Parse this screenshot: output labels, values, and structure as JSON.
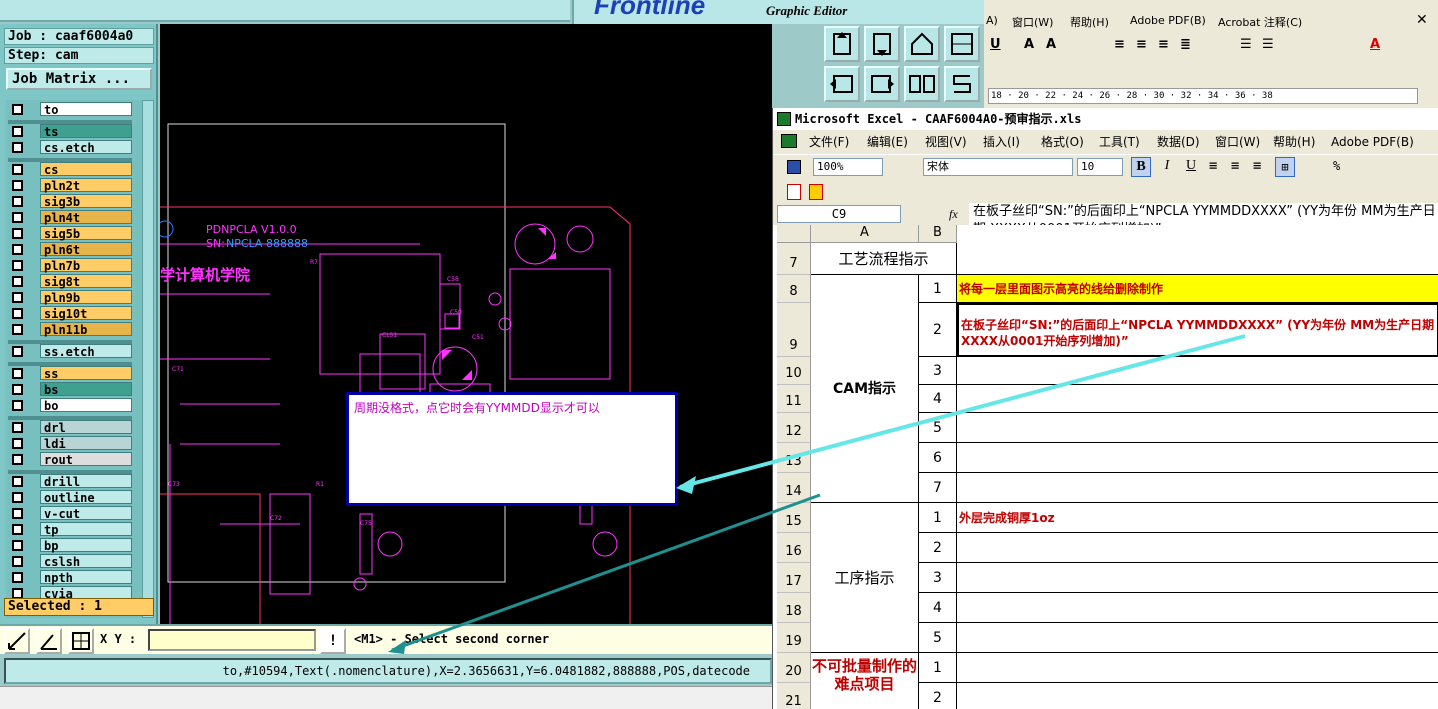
{
  "genesis": {
    "brand": "Frontline",
    "brand_sub": "Graphic Editor",
    "job": "Job : caaf6004a0",
    "step": "Step: cam",
    "job_matrix": "Job Matrix ...",
    "selected": "Selected : 1",
    "xy_label": "X Y :",
    "xy_value": "",
    "prompt": "<M1> - Select second corner",
    "status": "to,#10594,Text(.nomenclature),X=2.3656631,Y=6.0481882,888888,POS,datecode",
    "layers": [
      {
        "name": "to",
        "color": "#ffffff"
      },
      {
        "name": "ts",
        "color": "#3fa08f"
      },
      {
        "name": "cs.etch",
        "color": "#bfeaea"
      },
      {
        "name": "cs",
        "color": "#ffcc66"
      },
      {
        "name": "pln2t",
        "color": "#ffcc66"
      },
      {
        "name": "sig3b",
        "color": "#ffcc66"
      },
      {
        "name": "pln4t",
        "color": "#e8b44a"
      },
      {
        "name": "sig5b",
        "color": "#ffcc66"
      },
      {
        "name": "pln6t",
        "color": "#e8b44a"
      },
      {
        "name": "pln7b",
        "color": "#ffcc66"
      },
      {
        "name": "sig8t",
        "color": "#ffcc66"
      },
      {
        "name": "pln9b",
        "color": "#ffcc66"
      },
      {
        "name": "sig10t",
        "color": "#ffcc66"
      },
      {
        "name": "pln11b",
        "color": "#e8b44a"
      },
      {
        "name": "ss.etch",
        "color": "#bfeaea"
      },
      {
        "name": "ss",
        "color": "#ffcc66"
      },
      {
        "name": "bs",
        "color": "#3fa08f"
      },
      {
        "name": "bo",
        "color": "#ffffff"
      },
      {
        "name": "drl",
        "color": "#b9d4d4"
      },
      {
        "name": "ldi",
        "color": "#b9d4d4"
      },
      {
        "name": "rout",
        "color": "#dddddd"
      },
      {
        "name": "drill",
        "color": "#bfeaea"
      },
      {
        "name": "outline",
        "color": "#bfeaea"
      },
      {
        "name": "v-cut",
        "color": "#bfeaea"
      },
      {
        "name": "tp",
        "color": "#bfeaea"
      },
      {
        "name": "bp",
        "color": "#bfeaea"
      },
      {
        "name": "cslsh",
        "color": "#bfeaea"
      },
      {
        "name": "npth",
        "color": "#bfeaea"
      },
      {
        "name": "cvia",
        "color": "#bfeaea"
      }
    ],
    "board_text": {
      "title": "PDNPCLA V1.0.0",
      "sn_prefix": "SN:",
      "sn_value": "NPCLA 888888",
      "school": "学计算机学院",
      "c58": "C58",
      "c50": "C50",
      "c51": "C51",
      "cl51": "CL51",
      "r7": "R7",
      "c71": "C71",
      "c73": "C73",
      "c72": "C72",
      "c75": "C75",
      "r1": "R1"
    }
  },
  "note_text": "周期没格式，点它时会有YYMMDD显示才可以",
  "word": {
    "menu": [
      "A)",
      "窗口(W)",
      "帮助(H)",
      "Adobe PDF(B)",
      "Acrobat 注释(C)"
    ],
    "ruler": "18 · 20 · 22 · 24 · 26 · 28 · 30 · 32 · 34 · 36 · 38"
  },
  "excel": {
    "title": "Microsoft Excel - CAAF6004A0-预审指示.xls",
    "menu": [
      "文件(F)",
      "编辑(E)",
      "视图(V)",
      "插入(I)",
      "格式(O)",
      "工具(T)",
      "数据(D)",
      "窗口(W)",
      "帮助(H)",
      "Adobe PDF(B)"
    ],
    "zoom": "100%",
    "font": "宋体",
    "size": "10",
    "namebox": "C9",
    "fx": "fx",
    "formula": "在板子丝印“SN:”的后面印上“NPCLA YYMMDDXXXX” (YY为年份 MM为生产日期  XXXX从0001开始序列增加)”",
    "col_a": "A",
    "col_b": "B",
    "row_labels": [
      "7",
      "8",
      "9",
      "10",
      "11",
      "12",
      "13",
      "14",
      "15",
      "16",
      "17",
      "18",
      "19",
      "20",
      "21"
    ],
    "sections": {
      "flow": "工艺流程指示",
      "cam": "CAM指示",
      "process": "工序指示",
      "hard": "不可批量制作的难点项目"
    },
    "numbers": [
      "1",
      "2",
      "3",
      "4",
      "5",
      "6",
      "7",
      "1",
      "2",
      "3",
      "4",
      "5",
      "1",
      "2"
    ],
    "c8": "将每一层里面图示高亮的线给删除制作",
    "c9": "在板子丝印“SN:”的后面印上“NPCLA YYMMDDXXXX” (YY为年份 MM为生产日期  XXXX从0001开始序列增加)”",
    "c15": "外层完成铜厚1oz"
  },
  "colors": {
    "highlight_yellow": "#ffff00",
    "red_text": "#c00000",
    "note_border": "#0000aa",
    "magenta": "#ff33ff"
  }
}
